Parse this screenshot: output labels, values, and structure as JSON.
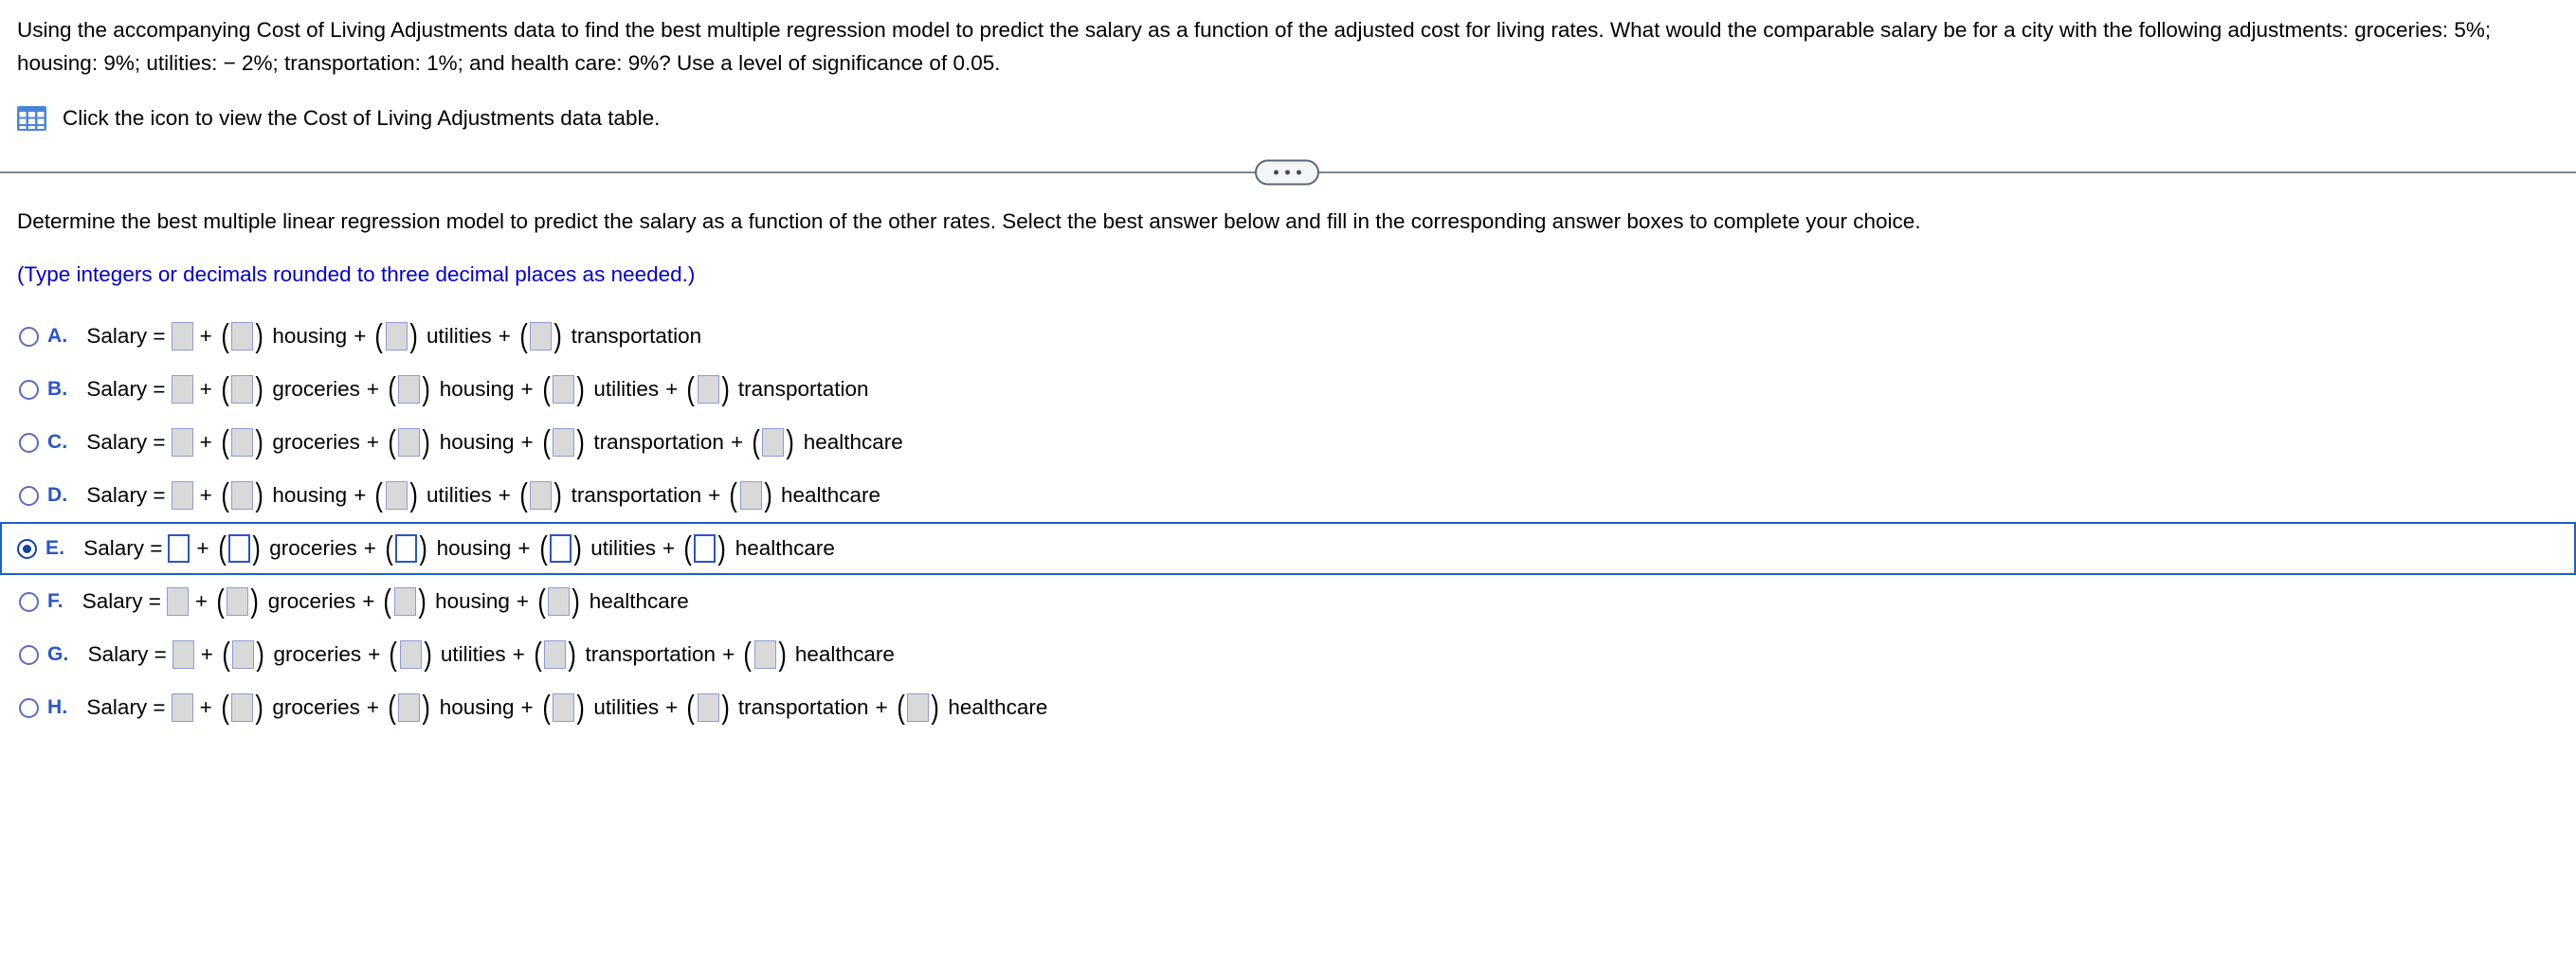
{
  "problem": {
    "text": "Using the accompanying Cost of Living Adjustments data to find the best multiple regression model to predict the salary as a function of the adjusted cost for living rates. What would the comparable salary be for a city with the following adjustments: groceries: 5%; housing: 9%; utilities: − 2%; transportation: 1%; and health care: 9%? Use a level of significance of 0.05.",
    "icon_name": "table-icon",
    "icon_caption": "Click the icon to view the Cost of Living Adjustments data table."
  },
  "divider": {
    "ellipsis_label": "•••"
  },
  "question": {
    "prompt": "Determine the best multiple linear regression model to predict the salary as a function of the other rates. Select the best answer below and fill in the corresponding answer boxes to complete your choice.",
    "hint": "(Type integers or decimals rounded to three decimal places as needed.)"
  },
  "colors": {
    "accent_blue": "#2b55c4",
    "hint_blue": "#0000cc",
    "selected_border": "#1862c6",
    "box_fill_inactive": "#d9d9d9",
    "box_border_inactive": "#8e9bd6",
    "divider_gray": "#7c8699",
    "icon_blue": "#4a86d8"
  },
  "options": [
    {
      "letter": "A.",
      "selected": false,
      "lead": "Salary =",
      "terms": [
        "housing",
        "utilities",
        "transportation"
      ],
      "plus": "+"
    },
    {
      "letter": "B.",
      "selected": false,
      "lead": "Salary =",
      "terms": [
        "groceries",
        "housing",
        "utilities",
        "transportation"
      ],
      "plus": "+"
    },
    {
      "letter": "C.",
      "selected": false,
      "lead": "Salary =",
      "terms": [
        "groceries",
        "housing",
        "transportation",
        "healthcare"
      ],
      "plus": "+"
    },
    {
      "letter": "D.",
      "selected": false,
      "lead": "Salary =",
      "terms": [
        "housing",
        "utilities",
        "transportation",
        "healthcare"
      ],
      "plus": "+"
    },
    {
      "letter": "E.",
      "selected": true,
      "lead": "Salary =",
      "terms": [
        "groceries",
        "housing",
        "utilities",
        "healthcare"
      ],
      "plus": "+"
    },
    {
      "letter": "F.",
      "selected": false,
      "lead": "Salary =",
      "terms": [
        "groceries",
        "housing",
        "healthcare"
      ],
      "plus": "+"
    },
    {
      "letter": "G.",
      "selected": false,
      "lead": "Salary =",
      "terms": [
        "groceries",
        "utilities",
        "transportation",
        "healthcare"
      ],
      "plus": "+"
    },
    {
      "letter": "H.",
      "selected": false,
      "lead": "Salary =",
      "terms": [
        "groceries",
        "housing",
        "utilities",
        "transportation",
        "healthcare"
      ],
      "plus": "+"
    }
  ]
}
